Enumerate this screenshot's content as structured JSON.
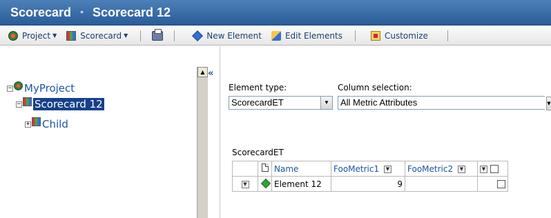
{
  "title": {
    "part1": "Scorecard",
    "separator": "•",
    "part2": "Scorecard 12"
  },
  "toolbar": {
    "project_label": "Project",
    "scorecard_label": "Scorecard",
    "new_element_label": "New Element",
    "edit_elements_label": "Edit Elements",
    "customize_label": "Customize"
  },
  "tree": {
    "root": "MyProject",
    "scorecard": "Scorecard 12",
    "child": "Child"
  },
  "form": {
    "element_type_label": "Element type:",
    "element_type_value": "ScorecardET",
    "column_selection_label": "Column selection:",
    "column_selection_value": "All Metric Attributes"
  },
  "grid": {
    "title": "ScorecardET",
    "headers": [
      "Name",
      "FooMetric1",
      "FooMetric2"
    ],
    "rows": [
      {
        "name": "Element 12",
        "foometric1": "9",
        "foometric2": ""
      }
    ]
  },
  "colors": {
    "title_bar": "#2a5d99",
    "link": "#1a53a6",
    "selection": "#16408a",
    "status_green": "#2fa52f"
  },
  "icons": [
    "project-icon",
    "scorecard-icon",
    "print-icon",
    "new-element-icon",
    "edit-elements-icon",
    "customize-icon",
    "diamond-status-icon",
    "document-icon"
  ]
}
